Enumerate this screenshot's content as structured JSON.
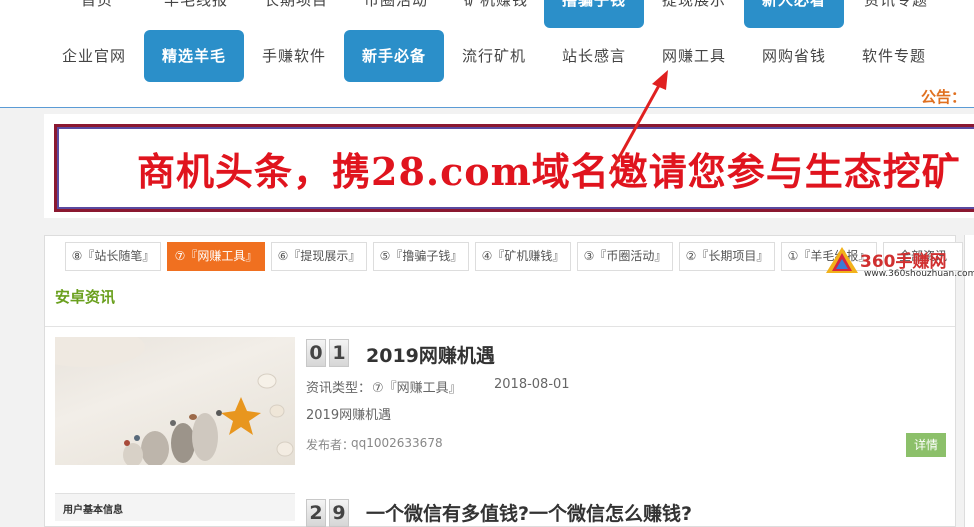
{
  "nav": {
    "row1": [
      "首页",
      "羊毛线报",
      "长期项目",
      "币圈活动",
      "矿机赚钱",
      "撸骗子钱",
      "提现展示",
      "新人必看",
      "资讯专题"
    ],
    "row2": [
      "企业官网",
      "精选羊毛",
      "手赚软件",
      "新手必备",
      "流行矿机",
      "站长感言",
      "网赚工具",
      "网购省钱",
      "软件专题"
    ]
  },
  "notice_label": "公告：",
  "banner_text": "商机头条，携28.com域名邀请您参与生态挖矿",
  "tabs": [
    "⑧『站长随笔』",
    "⑦『网赚工具』",
    "⑥『提现展示』",
    "⑤『撸骗子钱』",
    "④『矿机赚钱』",
    "③『币圈活动』",
    "②『长期项目』",
    "①『羊毛线报』",
    "全部资讯"
  ],
  "section_title": "安卓资讯",
  "logo": {
    "name": "360手赚网",
    "url": "www.360shouzhuan.com"
  },
  "articles": [
    {
      "rank": [
        "0",
        "1"
      ],
      "title": "2019网赚机遇",
      "type_label": "资讯类型：",
      "type_value": "⑦『网赚工具』",
      "date": "2018-08-01",
      "summary": "2019网赚机遇",
      "publisher_label": "发布者：",
      "publisher": "qq1002633678",
      "detail_label": "详情"
    },
    {
      "rank": [
        "2",
        "9"
      ],
      "title": "一个微信有多值钱?一个微信怎么赚钱?"
    }
  ],
  "user_box_label": "用户基本信息",
  "colors": {
    "accent_blue": "#2b8fc9",
    "active_tab": "#f07020",
    "banner_red": "#e0141e",
    "section_green": "#6aa01e",
    "detail_green": "#8cc06a"
  }
}
